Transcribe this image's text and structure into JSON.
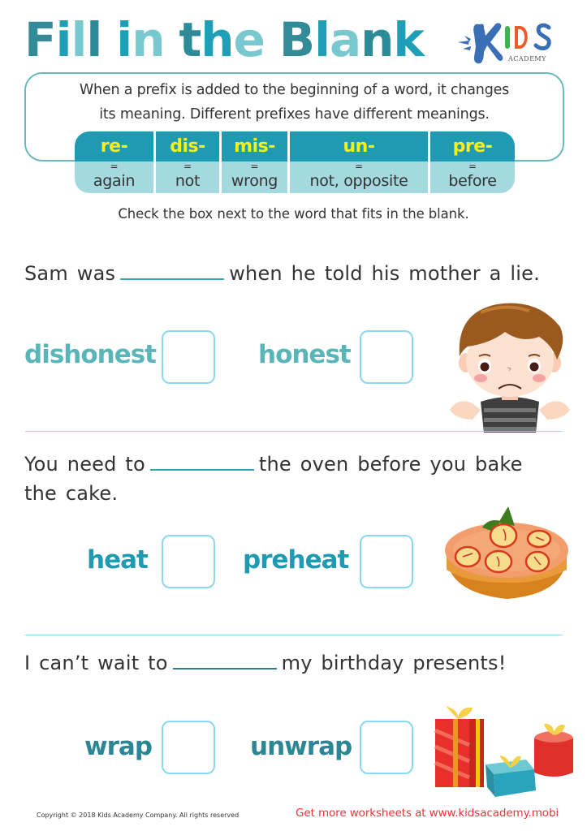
{
  "title": {
    "words": [
      {
        "text": "Fill",
        "letters": [
          {
            "ch": "F",
            "color": "c1"
          },
          {
            "ch": "i",
            "color": "c2"
          },
          {
            "ch": "l",
            "color": "c3"
          },
          {
            "ch": "l",
            "color": "c4"
          }
        ]
      },
      {
        "text": "in",
        "letters": [
          {
            "ch": "i",
            "color": "c2"
          },
          {
            "ch": "n",
            "color": "c3"
          }
        ]
      },
      {
        "text": "the",
        "letters": [
          {
            "ch": "t",
            "color": "c4"
          },
          {
            "ch": "h",
            "color": "c2"
          },
          {
            "ch": "e",
            "color": "c3"
          }
        ]
      },
      {
        "text": "Blank",
        "letters": [
          {
            "ch": "B",
            "color": "c1"
          },
          {
            "ch": "l",
            "color": "c2"
          },
          {
            "ch": "a",
            "color": "c3"
          },
          {
            "ch": "n",
            "color": "c4"
          },
          {
            "ch": "k",
            "color": "c2"
          }
        ]
      }
    ]
  },
  "logo": {
    "letters": [
      "K",
      "I",
      "D",
      "S"
    ],
    "subtext": "ACADEMY"
  },
  "intro": {
    "line1": "When a prefix is added to the beginning of a word, it changes",
    "line2": "its meaning. Different prefixes have different meanings."
  },
  "prefixes": [
    {
      "prefix": "re-",
      "equals": "=",
      "meaning": "again"
    },
    {
      "prefix": "dis-",
      "equals": "=",
      "meaning": "not"
    },
    {
      "prefix": "mis-",
      "equals": "=",
      "meaning": "wrong"
    },
    {
      "prefix": "un-",
      "equals": "=",
      "meaning": "not, opposite"
    },
    {
      "prefix": "pre-",
      "equals": "=",
      "meaning": "before"
    }
  ],
  "instructions": "Check the box next to the word that fits in the blank.",
  "questions": [
    {
      "before": "Sam was",
      "after": "when he told his mother a lie.",
      "choices": [
        {
          "word": "dishonest",
          "color": "#5ab5b8",
          "checked": false
        },
        {
          "word": "honest",
          "color": "#5ab5b8",
          "checked": false
        }
      ],
      "illustration": "sad-boy"
    },
    {
      "before": "You need to",
      "after": "the oven before you bake",
      "after_line2": "the cake.",
      "choices": [
        {
          "word": "heat",
          "color": "#1f9ab3",
          "checked": false
        },
        {
          "word": "preheat",
          "color": "#1f9ab3",
          "checked": false
        }
      ],
      "illustration": "apple-cake"
    },
    {
      "before": "I can’t wait to",
      "after": "my birthday presents!",
      "choices": [
        {
          "word": "wrap",
          "color": "#2d8695",
          "checked": false
        },
        {
          "word": "unwrap",
          "color": "#2d8695",
          "checked": false
        }
      ],
      "illustration": "gift-boxes"
    }
  ],
  "footer": {
    "copyright": "Copyright © 2018 Kids Academy Company. All rights reserved",
    "promo": "Get more worksheets at www.kidsacademy.mobi"
  }
}
